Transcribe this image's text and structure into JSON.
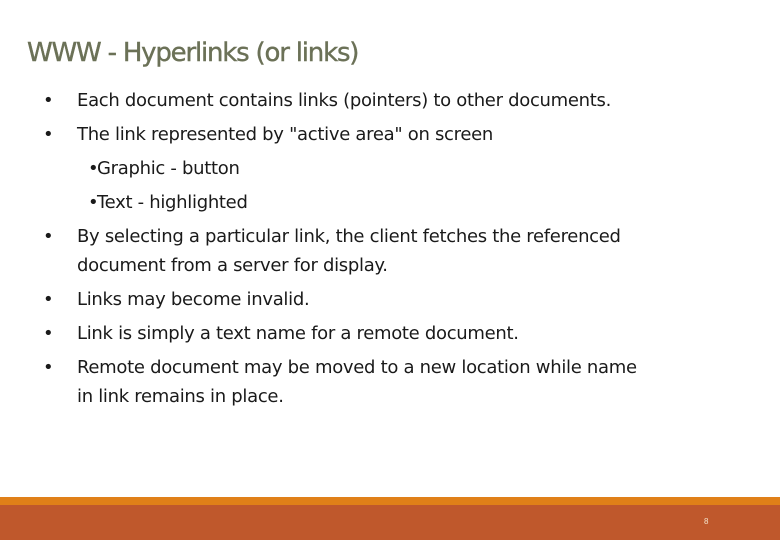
{
  "slide": {
    "title": "WWW - Hyperlinks (or links)",
    "bullets": [
      {
        "bullet": "•",
        "lines": [
          "Each document contains links (pointers) to other documents."
        ]
      },
      {
        "bullet": "•",
        "lines": [
          "The link represented by \"active area\" on screen"
        ]
      },
      {
        "bullet": "•",
        "sub": true,
        "lines": [
          "Graphic - button"
        ]
      },
      {
        "bullet": "•",
        "sub": true,
        "lines": [
          "Text - highlighted"
        ]
      },
      {
        "bullet": "•",
        "lines": [
          "By selecting a particular link, the client fetches the referenced",
          "document from a server for display."
        ]
      },
      {
        "bullet": "•",
        "lines": [
          "Links may become invalid."
        ]
      },
      {
        "bullet": "•",
        "lines": [
          "Link is simply a text name for a remote document."
        ]
      },
      {
        "bullet": "•",
        "lines": [
          "Remote document may be moved to a new location while name",
          "in link remains in place."
        ]
      }
    ],
    "page_number": "8"
  },
  "colors": {
    "title": "#6b7157",
    "footer_strip": "#e08018",
    "footer_band": "#bf582c"
  }
}
